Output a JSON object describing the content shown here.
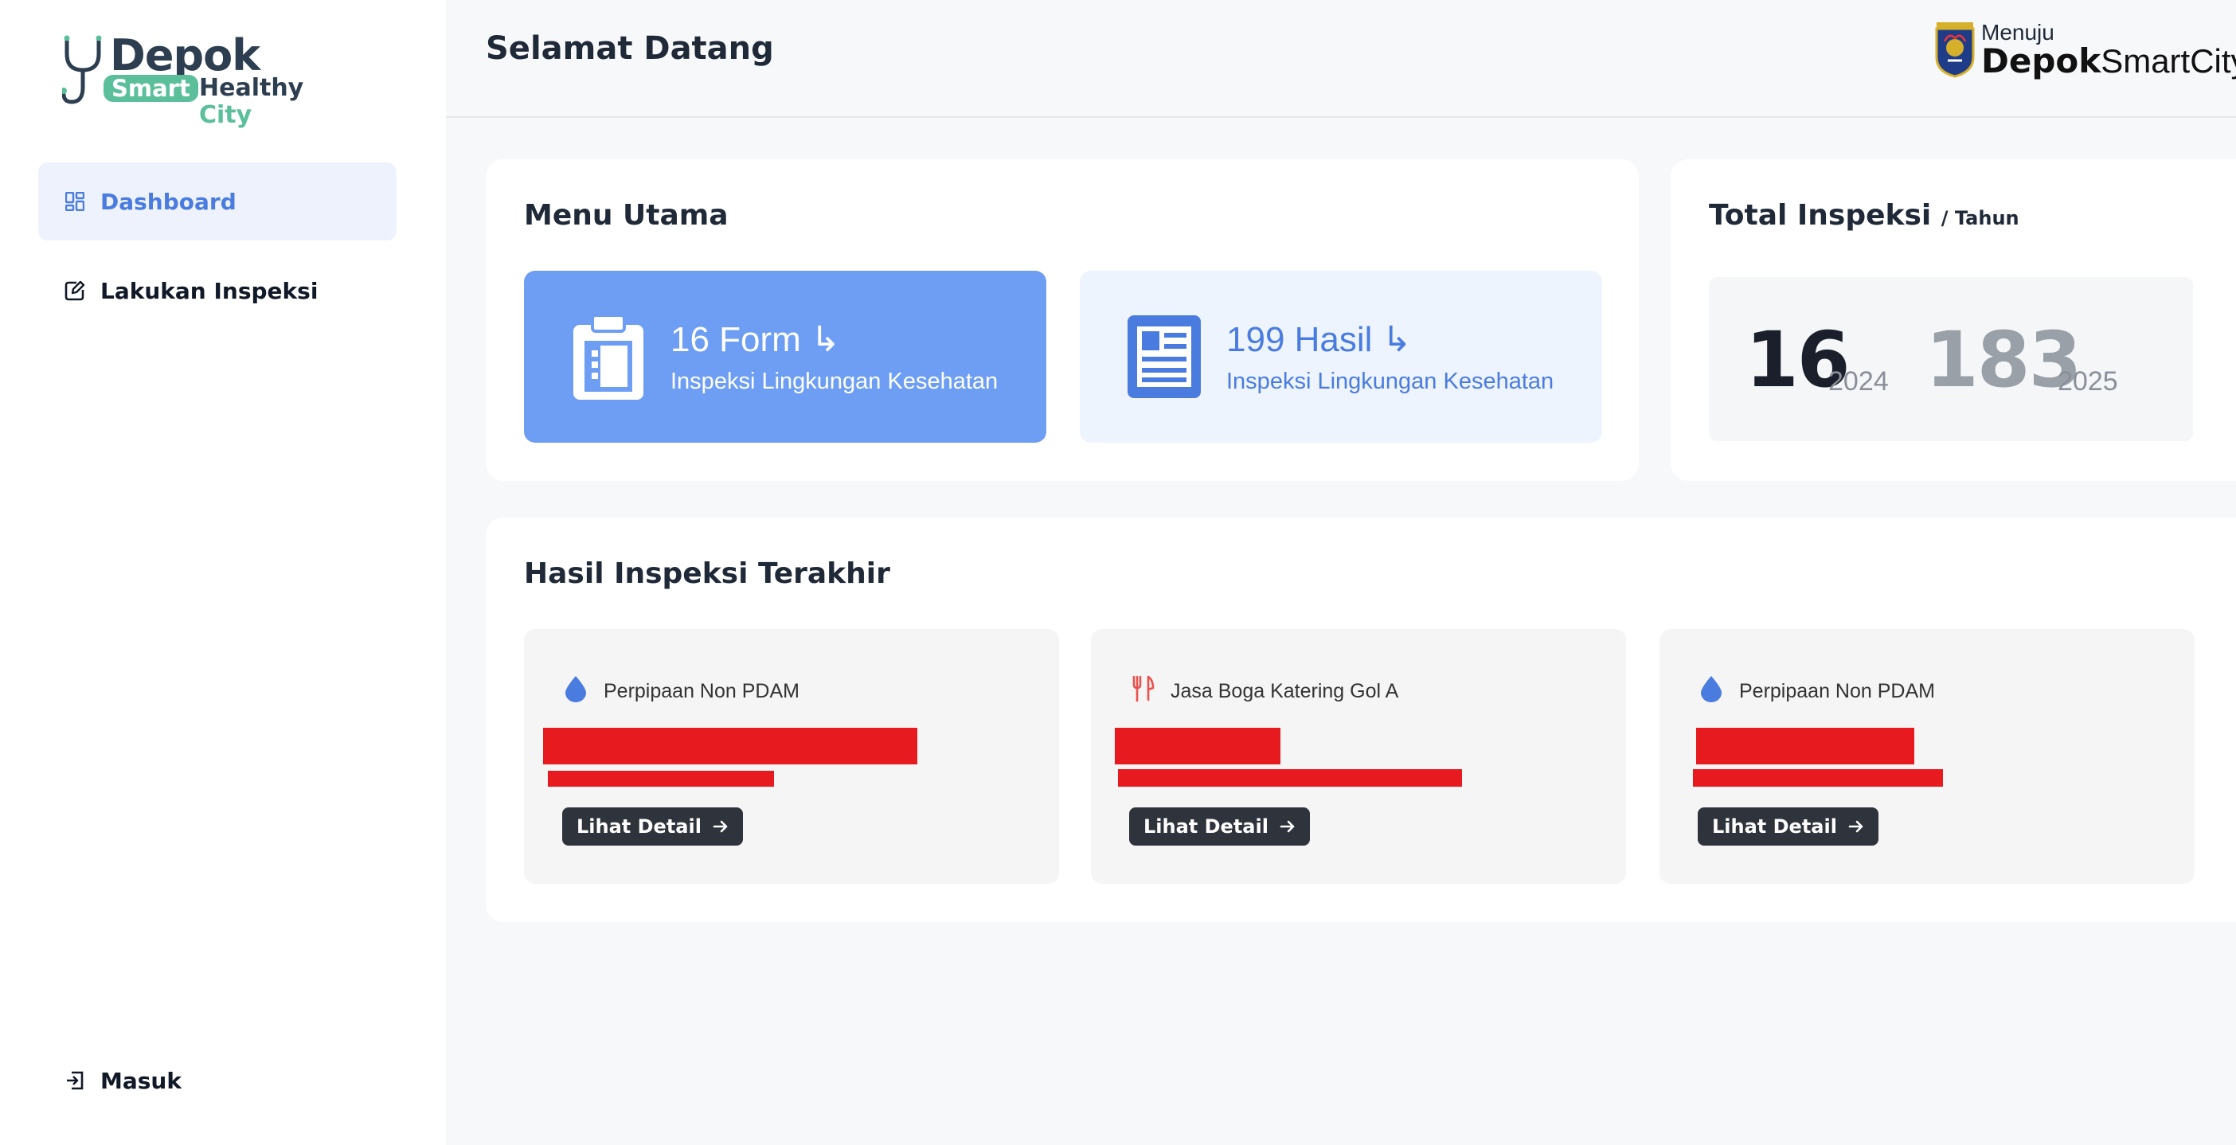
{
  "sidebar": {
    "logo": {
      "word1": "Depok",
      "word2": "Smart",
      "word3": "Healthy",
      "word4": "City"
    },
    "items": [
      {
        "label": "Dashboard",
        "icon": "dashboard-grid-icon",
        "active": true
      },
      {
        "label": "Lakukan Inspeksi",
        "icon": "edit-document-icon",
        "active": false
      }
    ],
    "footer": {
      "label": "Masuk",
      "icon": "login-icon"
    }
  },
  "header": {
    "title": "Selamat Datang",
    "brand": {
      "prefix": "Menuju",
      "bold": "Depok",
      "rest": "SmartCity"
    }
  },
  "menu_utama": {
    "title": "Menu Utama",
    "tiles": [
      {
        "count": "16 Form",
        "arrow": "↳",
        "subtitle": "Inspeksi Lingkungan Kesehatan",
        "icon": "clipboard-icon"
      },
      {
        "count": "199 Hasil",
        "arrow": "↳",
        "subtitle": "Inspeksi Lingkungan Kesehatan",
        "icon": "document-list-icon"
      }
    ]
  },
  "total_inspeksi": {
    "title": "Total Inspeksi",
    "suffix": "/ Tahun",
    "stats": [
      {
        "value": "16",
        "year": "2024"
      },
      {
        "value": "183",
        "year": "2025"
      }
    ]
  },
  "hasil_inspeksi": {
    "title": "Hasil Inspeksi Terakhir",
    "cards": [
      {
        "category": "Perpipaan Non PDAM",
        "icon": "water-drop-icon",
        "button": "Lihat Detail"
      },
      {
        "category": "Jasa Boga Katering Gol A",
        "icon": "fork-knife-icon",
        "button": "Lihat Detail"
      },
      {
        "category": "Perpipaan Non PDAM",
        "icon": "water-drop-icon",
        "button": "Lihat Detail"
      }
    ]
  },
  "colors": {
    "accent_blue": "#4a7ce0",
    "tile_blue": "#6d9ef3",
    "tile_light": "#eef4fe",
    "logo_green": "#5bbf9b",
    "redaction": "#e61a1f",
    "button_dark": "#2f343c"
  }
}
